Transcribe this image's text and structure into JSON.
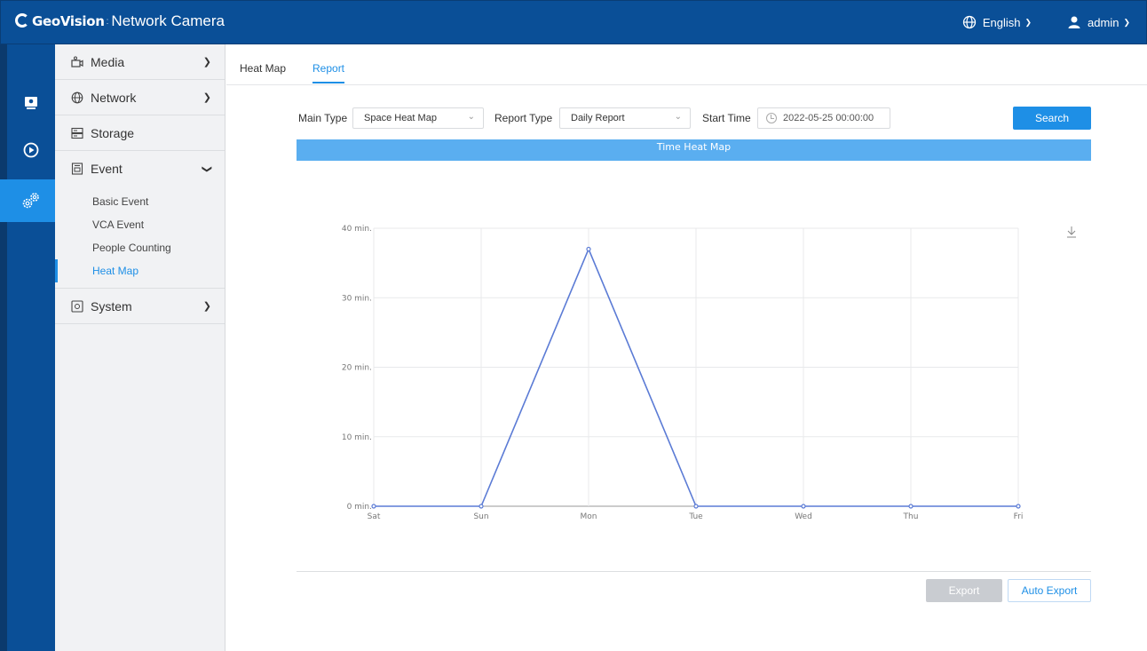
{
  "header": {
    "brand_logo": "GeoVision",
    "brand_sep": ":",
    "title": "Network Camera",
    "language": "English",
    "user": "admin"
  },
  "rail": {
    "items": [
      {
        "icon": "live-view-icon"
      },
      {
        "icon": "playback-icon"
      },
      {
        "icon": "settings-icon",
        "active": true
      }
    ]
  },
  "sidebar": {
    "media": "Media",
    "network": "Network",
    "storage": "Storage",
    "event": "Event",
    "event_items": [
      "Basic Event",
      "VCA Event",
      "People Counting",
      "Heat Map"
    ],
    "system": "System"
  },
  "tabs": [
    "Heat Map",
    "Report"
  ],
  "filters": {
    "main_type_label": "Main Type",
    "main_type_value": "Space Heat Map",
    "report_type_label": "Report Type",
    "report_type_value": "Daily Report",
    "start_time_label": "Start Time",
    "start_time_value": "2022-05-25 00:00:00",
    "search": "Search"
  },
  "chart_data": {
    "type": "line",
    "title": "Time Heat Map",
    "categories": [
      "Sat",
      "Sun",
      "Mon",
      "Tue",
      "Wed",
      "Thu",
      "Fri"
    ],
    "values": [
      0,
      0,
      37,
      0,
      0,
      0,
      0
    ],
    "y_ticks": [
      "0 min.",
      "10 min.",
      "20 min.",
      "30 min.",
      "40 min."
    ],
    "ylim": [
      0,
      40
    ],
    "grid": true,
    "color": "#5b7bd5"
  },
  "actions": {
    "export": "Export",
    "auto_export": "Auto Export"
  },
  "colors": {
    "header": "#0a4f97",
    "accent": "#1e8fe6",
    "title_bar": "#5aaef0"
  }
}
